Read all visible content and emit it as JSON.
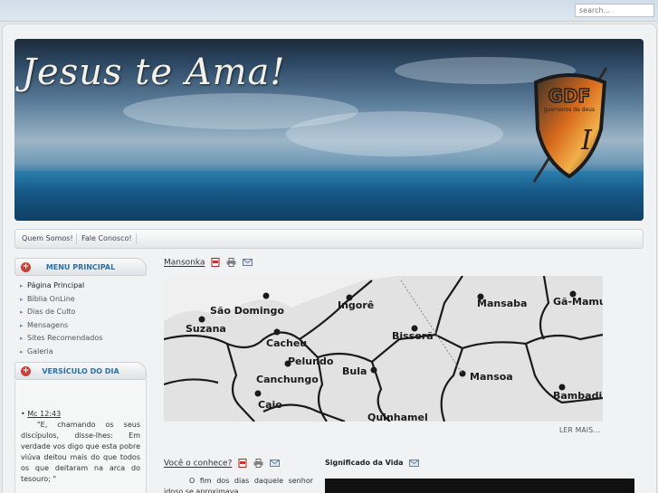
{
  "search": {
    "placeholder": "search..."
  },
  "banner": {
    "title": "Jesus te Ama!",
    "logo_text": "guerreiros de deus"
  },
  "nav": {
    "items": [
      "Quem Somos!",
      "Fale Conosco!"
    ]
  },
  "sidebar": {
    "menu_title": "MENU PRINCIPAL",
    "menu_items": [
      "Página Principal",
      "Bíblia OnLine",
      "Dias de Culto",
      "Mensagens",
      "Sites Recomendados",
      "Galeria"
    ],
    "verse_title": "VERSÍCULO DO DIA",
    "verse_ref": "Mc 12:43",
    "verse_text": "\"E, chamando os seus discípulos, disse-lhes: Em verdade vos digo que esta pobre viúva deitou mais do que todos os que deitaram na arca do tesouro; \""
  },
  "article": {
    "title": "Mansonka",
    "read_more": "LER MAIS...",
    "map_labels": [
      "São Domingo",
      "Suzana",
      "Ingorê",
      "Mansaba",
      "Gã-Mamu",
      "Cacheu",
      "Bissorã",
      "Pelundo",
      "Canchungo",
      "Bula",
      "Mansoa",
      "Bambadinc",
      "Caio",
      "Quinhamel"
    ]
  },
  "article2": {
    "title": "Você o conhece?",
    "text": "O fim dos dias daquele senhor idoso se aproximava"
  },
  "article3": {
    "title": "Significado da Vida"
  },
  "colors": {
    "accent": "#2f6fa3",
    "plus": "#c9413a"
  }
}
